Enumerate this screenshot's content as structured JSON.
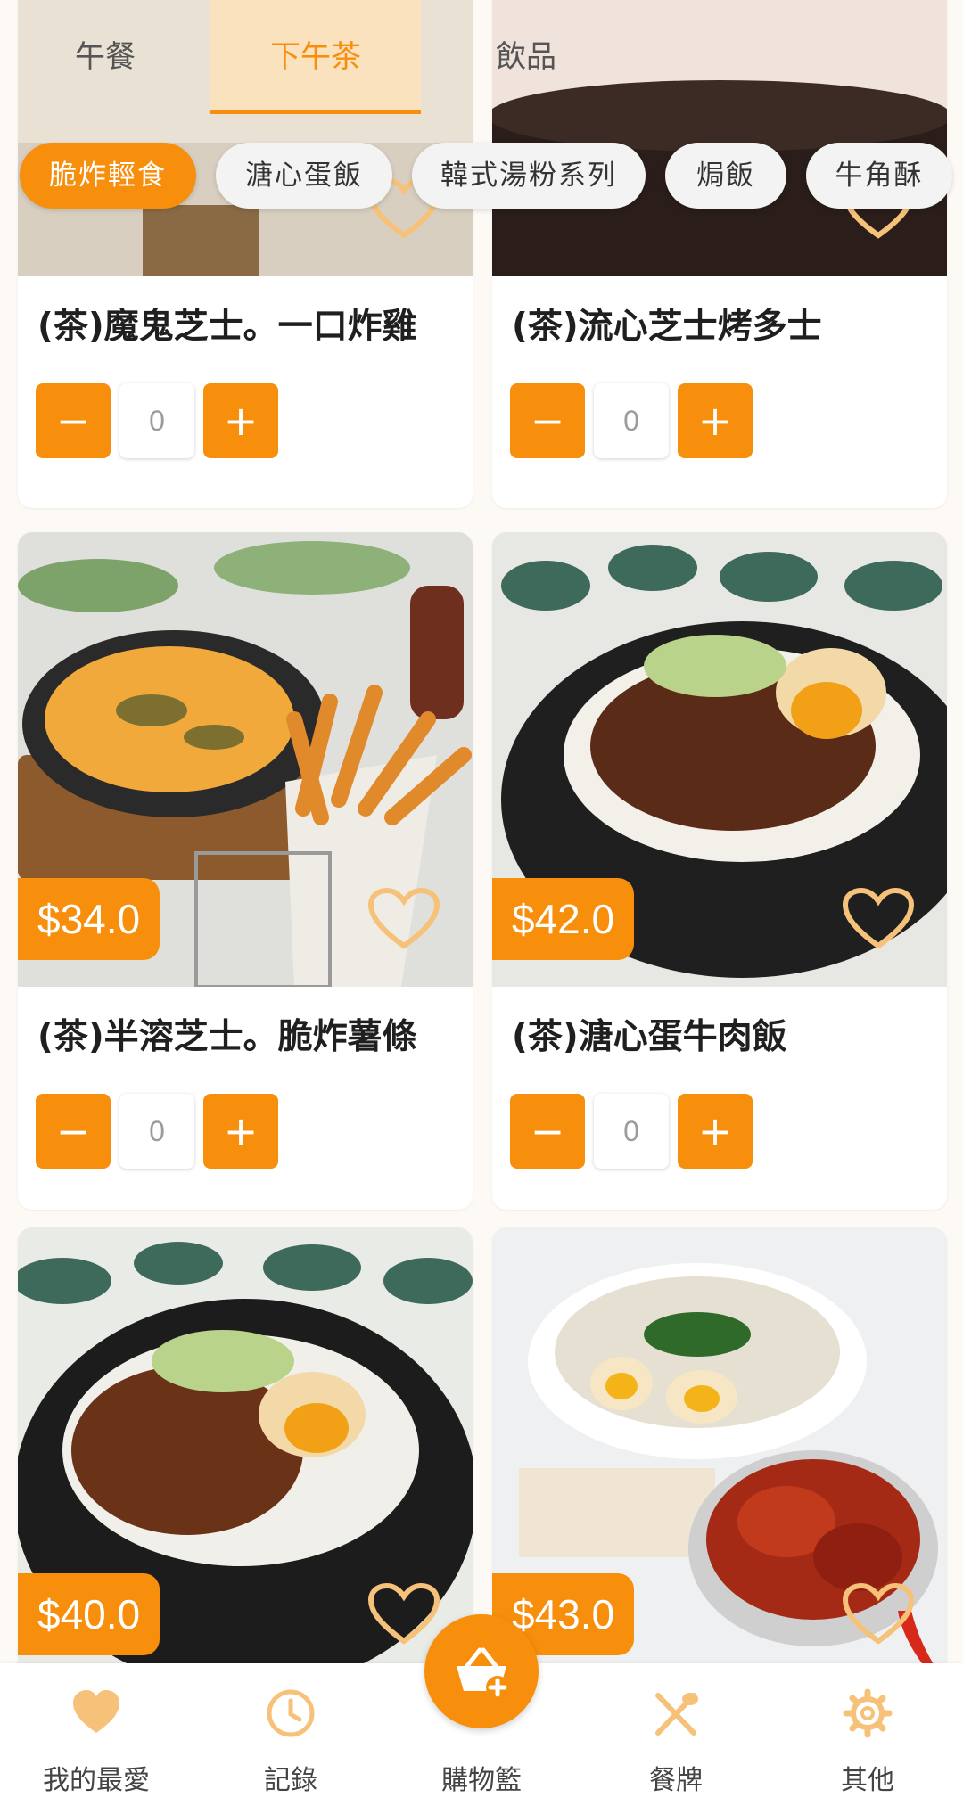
{
  "tabs": [
    {
      "label": "午餐"
    },
    {
      "label": "下午茶"
    },
    {
      "label": "飲品"
    }
  ],
  "active_tab": "下午茶",
  "chips": [
    {
      "label": "脆炸輕食"
    },
    {
      "label": "溏心蛋飯"
    },
    {
      "label": "韓式湯粉系列"
    },
    {
      "label": "焗飯"
    },
    {
      "label": "牛角酥"
    }
  ],
  "active_chip": "脆炸輕食",
  "products": [
    {
      "name": "(茶)魔鬼芝士。一口炸雞",
      "price": "",
      "quantity": "0",
      "favorite": false
    },
    {
      "name": "(茶)流心芝士烤多士",
      "price": "",
      "quantity": "0",
      "favorite": false
    },
    {
      "name": "(茶)半溶芝士。脆炸薯條",
      "price": "$34.0",
      "quantity": "0",
      "favorite": false
    },
    {
      "name": "(茶)溏心蛋牛肉飯",
      "price": "$42.0",
      "quantity": "0",
      "favorite": false
    },
    {
      "name": "",
      "price": "$40.0",
      "quantity": "",
      "favorite": false
    },
    {
      "name": "",
      "price": "$43.0",
      "quantity": "",
      "favorite": false
    }
  ],
  "quantity_controls": {
    "minus": "−",
    "plus": "+"
  },
  "bottom_nav": [
    {
      "label": "我的最愛",
      "icon": "heart-icon"
    },
    {
      "label": "記錄",
      "icon": "clock-icon"
    },
    {
      "label": "購物籃",
      "icon": "cart-icon"
    },
    {
      "label": "餐牌",
      "icon": "fork-spoon-icon"
    },
    {
      "label": "其他",
      "icon": "gear-icon"
    }
  ],
  "colors": {
    "accent": "#f78f0d",
    "tab_highlight": "#ffe2b8",
    "heart_outline": "#f6c27a"
  }
}
